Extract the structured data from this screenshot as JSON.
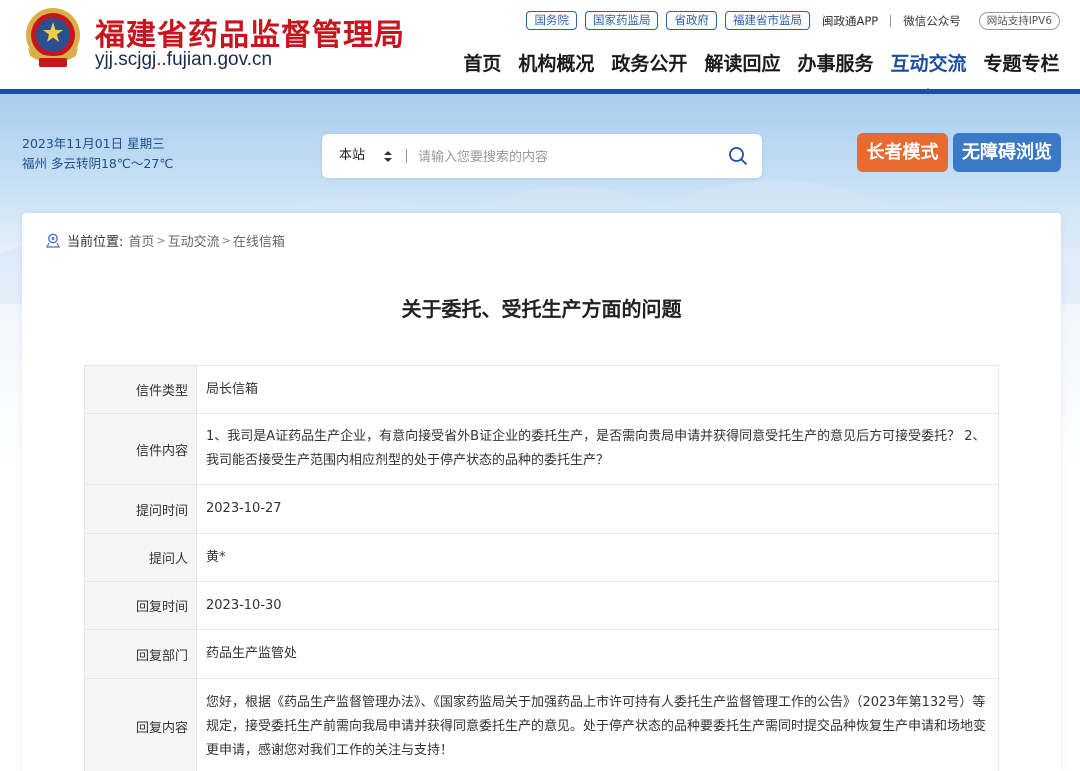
{
  "header": {
    "title": "福建省药品监督管理局",
    "domain_prefix": "yjj.scjgj",
    "domain_suffix": ".fujian.gov.cn",
    "top_links": [
      "国务院",
      "国家药监局",
      "省政府",
      "福建省市监局"
    ],
    "app_link": "闽政通APP",
    "wechat_link": "微信公众号",
    "ipv6_badge": "网站支持IPV6",
    "nav": [
      "首页",
      "机构概况",
      "政务公开",
      "解读回应",
      "办事服务",
      "互动交流",
      "专题专栏"
    ],
    "active_nav": "互动交流"
  },
  "banner": {
    "date": "2023年11月01日 星期三",
    "weather": "福州 多云转阴18℃～27℃",
    "search_scope": "本站",
    "search_placeholder": "请输入您要搜索的内容",
    "elder_mode": "长者模式",
    "accessible": "无障碍浏览"
  },
  "breadcrumb": {
    "label": "当前位置:",
    "items": [
      "首页",
      "互动交流",
      "在线信箱"
    ]
  },
  "letter": {
    "title": "关于委托、受托生产方面的问题",
    "rows": [
      {
        "label": "信件类型",
        "value": "局长信箱"
      },
      {
        "label": "信件内容",
        "value": "1、我司是A证药品生产企业，有意向接受省外B证企业的委托生产，是否需向贵局申请并获得同意受托生产的意见后方可接受委托？ 2、我司能否接受生产范围内相应剂型的处于停产状态的品种的委托生产？"
      },
      {
        "label": "提问时间",
        "value": "2023-10-27"
      },
      {
        "label": "提问人",
        "value": "黄*"
      },
      {
        "label": "回复时间",
        "value": "2023-10-30"
      },
      {
        "label": "回复部门",
        "value": "药品生产监管处"
      },
      {
        "label": "回复内容",
        "value": "您好，根据《药品生产监督管理办法》、《国家药监局关于加强药品上市许可持有人委托生产监督管理工作的公告》（2023年第132号）等规定，接受委托生产前需向我局申请并获得同意委托生产的意见。处于停产状态的品种要委托生产需同时提交品种恢复生产申请和场地变更申请，感谢您对我们工作的关注与支持！"
      }
    ]
  },
  "colors": {
    "brand_red": "#c8151d",
    "brand_blue": "#1a4f9c",
    "elder_orange": "#e86a2e",
    "access_blue": "#3a79c6"
  },
  "icons": [
    "national-emblem-icon",
    "search-icon",
    "location-pin-icon",
    "sort-arrows-icon"
  ]
}
